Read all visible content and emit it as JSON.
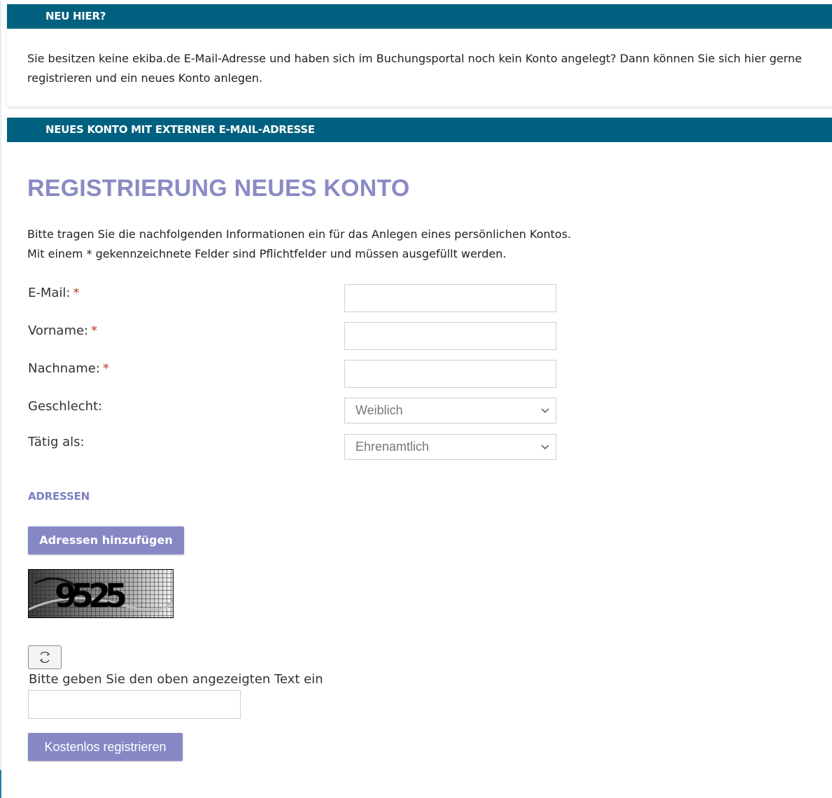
{
  "info": {
    "header": "NEU HIER?",
    "text": "Sie besitzen keine ekiba.de E-Mail-Adresse und haben sich im Buchungsportal noch kein Konto angelegt? Dann können Sie sich hier gerne registrieren und ein neues Konto anlegen."
  },
  "register": {
    "header": "NEUES KONTO MIT EXTERNER E-MAIL-ADRESSE",
    "title": "REGISTRIERUNG NEUES KONTO",
    "intro_line1": "Bitte tragen Sie die nachfolgenden Informationen ein für das Anlegen eines persönlichen Kontos.",
    "intro_line2": "Mit einem * gekennzeichnete Felder sind Pflichtfelder und müssen ausgefüllt werden.",
    "required_marker": "*",
    "fields": {
      "email": {
        "label": "E-Mail:",
        "value": ""
      },
      "firstname": {
        "label": "Vorname:",
        "value": ""
      },
      "lastname": {
        "label": "Nachname:",
        "value": ""
      },
      "gender": {
        "label": "Geschlecht:",
        "selected": "Weiblich"
      },
      "role": {
        "label": "Tätig als:",
        "selected": "Ehrenamtlich"
      }
    },
    "addresses": {
      "heading": "ADRESSEN",
      "add_button": "Adressen hinzufügen"
    },
    "captcha": {
      "code": "9525",
      "prompt": "Bitte geben Sie den oben angezeigten Text ein",
      "value": "",
      "refresh_icon": "refresh-icon"
    },
    "submit_button": "Kostenlos registrieren"
  },
  "colors": {
    "header_bar": "#00607f",
    "title": "#8a8bc4",
    "button": "#8688c6",
    "required": "#c0392b"
  }
}
